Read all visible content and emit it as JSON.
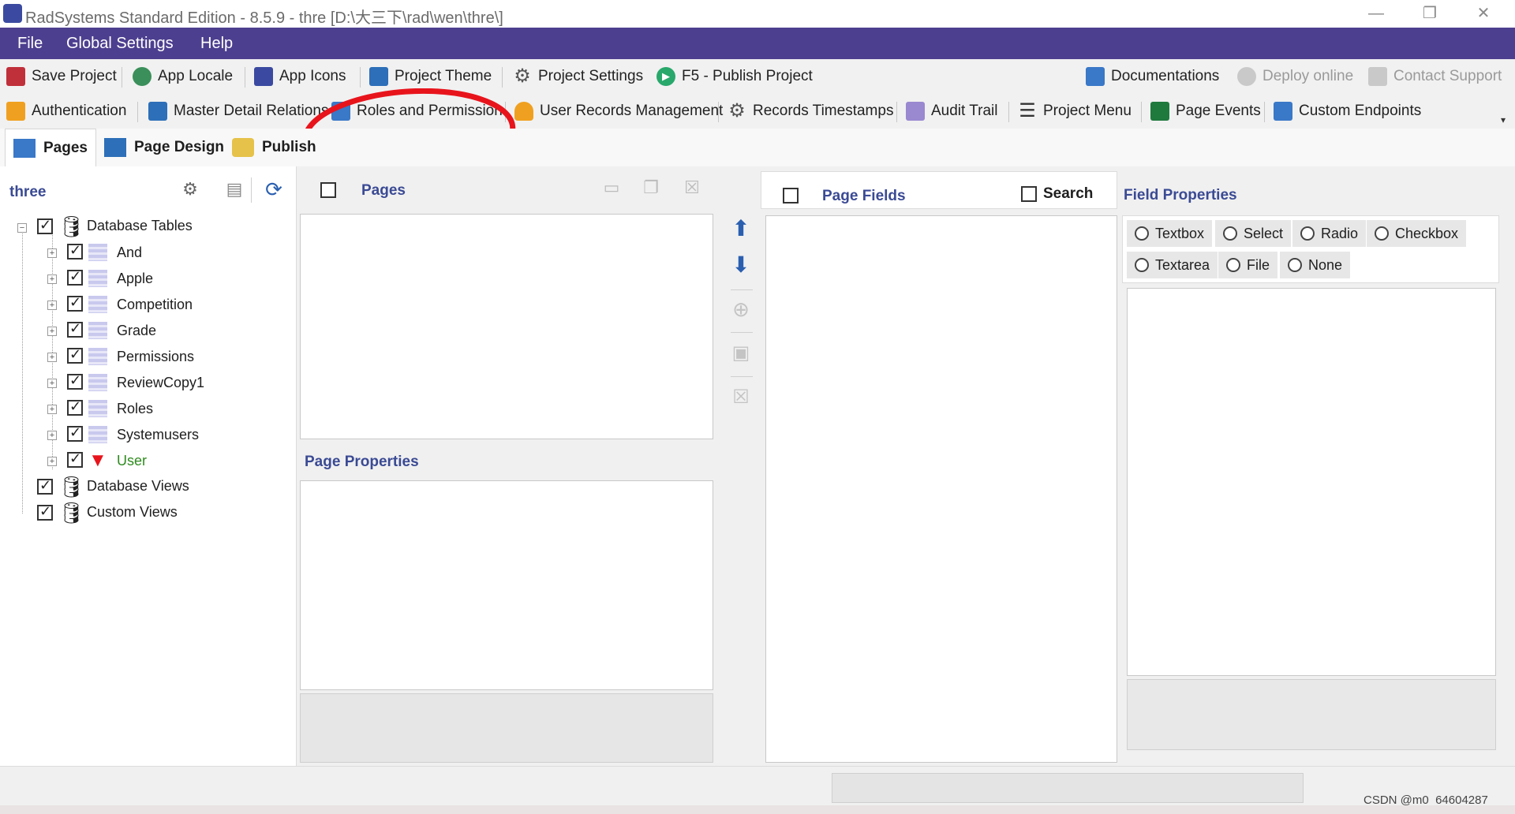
{
  "window": {
    "title": "RadSystems Standard Edition - 8.5.9 - thre [D:\\大三下\\rad\\wen\\thre\\]",
    "controls": {
      "minimize": "—",
      "restore": "❐",
      "close": "✕"
    }
  },
  "menu": {
    "items": [
      "File",
      "Global Settings",
      "Help"
    ]
  },
  "toolbar1": {
    "items": [
      {
        "label": "Save Project",
        "icon": "save-icon"
      },
      {
        "label": "App Locale",
        "icon": "globe-icon"
      },
      {
        "label": "App Icons",
        "icon": "app-icon"
      },
      {
        "label": "Project Theme",
        "icon": "theme-icon"
      },
      {
        "label": "Project Settings",
        "icon": "gear-icon"
      },
      {
        "label": "F5 - Publish Project",
        "icon": "play-icon"
      }
    ],
    "right_items": [
      {
        "label": "Documentations",
        "icon": "docs-icon"
      },
      {
        "label": "Deploy online",
        "icon": "cloud-icon"
      },
      {
        "label": "Contact Support",
        "icon": "support-icon"
      }
    ]
  },
  "toolbar2": {
    "items": [
      {
        "label": "Authentication",
        "icon": "lock-icon"
      },
      {
        "label": "Master Detail Relations",
        "icon": "master-detail-icon"
      },
      {
        "label": "Roles and Permission",
        "icon": "roles-icon"
      },
      {
        "label": "User Records Management",
        "icon": "user-icon"
      },
      {
        "label": "Records Timestamps",
        "icon": "gears-icon"
      },
      {
        "label": "Audit Trail",
        "icon": "audit-icon"
      },
      {
        "label": "Project Menu",
        "icon": "menu-icon"
      },
      {
        "label": "Page Events",
        "icon": "monitor-icon"
      },
      {
        "label": "Custom Endpoints",
        "icon": "list-icon"
      }
    ]
  },
  "tabs": [
    {
      "label": "Pages",
      "icon": "pages-icon",
      "active": true
    },
    {
      "label": "Page Design",
      "icon": "layout-icon",
      "active": false
    },
    {
      "label": "Publish",
      "icon": "publish-icon",
      "active": false
    }
  ],
  "explorer": {
    "project_name": "three",
    "root_nodes": [
      {
        "label": "Database Tables",
        "checked": true,
        "expanded": true
      },
      {
        "label": "Database Views",
        "checked": true
      },
      {
        "label": "Custom Views",
        "checked": true
      }
    ],
    "tables": [
      {
        "label": "And",
        "checked": true
      },
      {
        "label": "Apple",
        "checked": true
      },
      {
        "label": "Competition",
        "checked": true
      },
      {
        "label": "Grade",
        "checked": true
      },
      {
        "label": "Permissions",
        "checked": true
      },
      {
        "label": "ReviewCopy1",
        "checked": true
      },
      {
        "label": "Roles",
        "checked": true
      },
      {
        "label": "Systemusers",
        "checked": true
      },
      {
        "label": "User",
        "checked": true,
        "highlight_color": "#2e8b1e"
      }
    ]
  },
  "pages_panel": {
    "header": "Pages",
    "properties_label": "Page Properties"
  },
  "fields_panel": {
    "header": "Page Fields",
    "search_label": "Search"
  },
  "field_properties": {
    "header": "Field Properties",
    "types_row1": [
      "Textbox",
      "Select",
      "Radio",
      "Checkbox"
    ],
    "types_row2": [
      "Textarea",
      "File",
      "None"
    ]
  },
  "watermark": "CSDN @m0_64604287",
  "colors": {
    "menu_bar": "#4d3f8f",
    "accent_label": "#3a4a94",
    "annotation": "#e8141c"
  }
}
